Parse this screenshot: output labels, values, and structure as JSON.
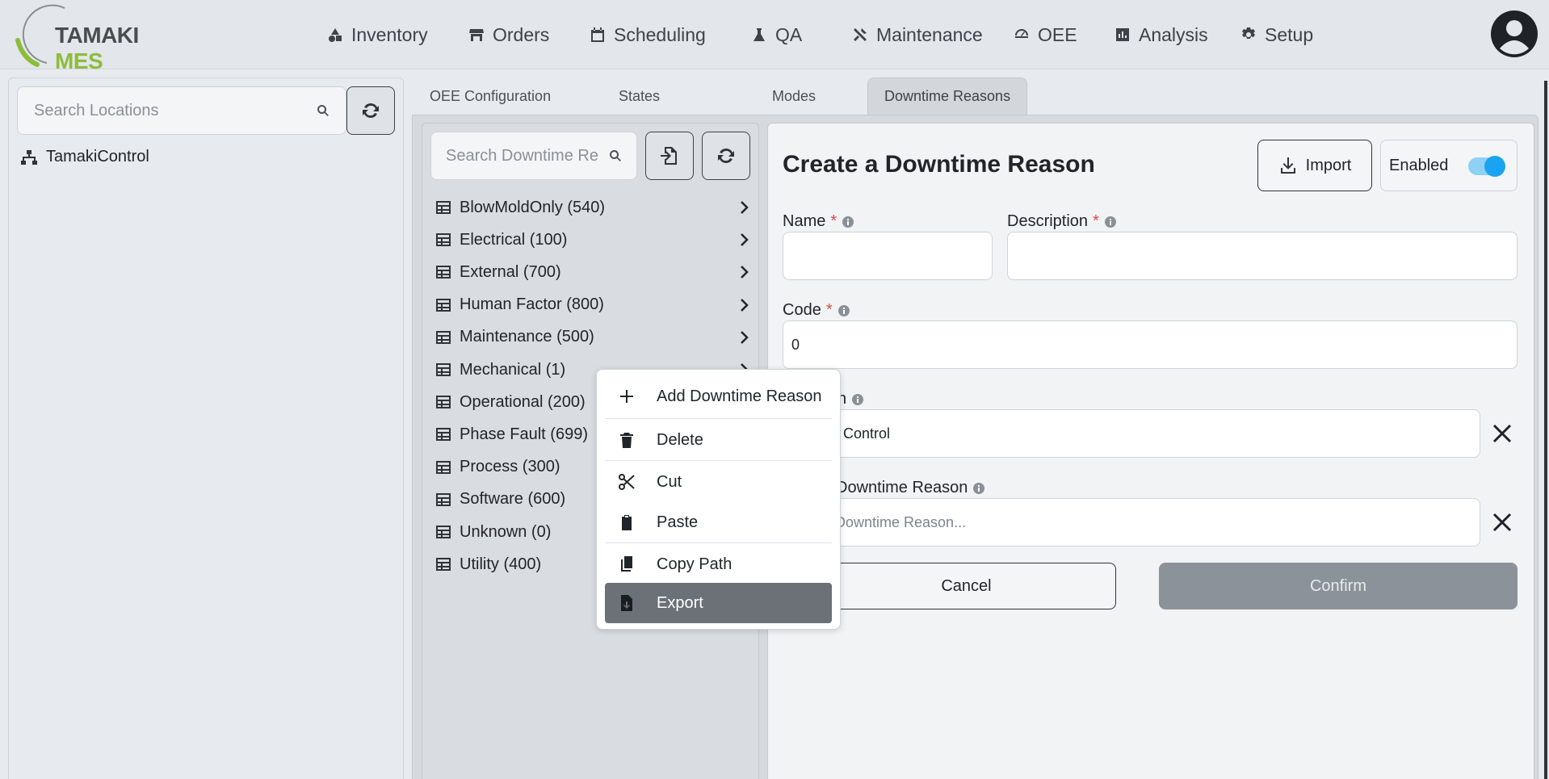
{
  "logo": {
    "part1": "TAMAKI",
    "part2": "MES"
  },
  "nav": [
    {
      "id": "inventory",
      "label": "Inventory",
      "icon": "shapes-icon"
    },
    {
      "id": "orders",
      "label": "Orders",
      "icon": "store-icon"
    },
    {
      "id": "scheduling",
      "label": "Scheduling",
      "icon": "calendar-icon"
    },
    {
      "id": "qa",
      "label": "QA",
      "icon": "flask-icon"
    },
    {
      "id": "maintenance",
      "label": "Maintenance",
      "icon": "tools-icon"
    },
    {
      "id": "oee",
      "label": "OEE",
      "icon": "gauge-icon"
    },
    {
      "id": "analysis",
      "label": "Analysis",
      "icon": "chart-icon"
    },
    {
      "id": "setup",
      "label": "Setup",
      "icon": "gear-icon"
    }
  ],
  "locations": {
    "search_placeholder": "Search Locations",
    "root": "TamakiControl"
  },
  "tabs": [
    {
      "label": "OEE Configuration",
      "active": false
    },
    {
      "label": "States",
      "active": false
    },
    {
      "label": "Modes",
      "active": false
    },
    {
      "label": "Downtime Reasons",
      "active": true
    }
  ],
  "reasons": {
    "search_placeholder": "Search Downtime Re",
    "items": [
      "BlowMoldOnly (540)",
      "Electrical (100)",
      "External (700)",
      "Human Factor (800)",
      "Maintenance (500)",
      "Mechanical (1)",
      "Operational (200)",
      "Phase Fault (699)",
      "Process (300)",
      "Software (600)",
      "Unknown (0)",
      "Utility (400)"
    ]
  },
  "form": {
    "title": "Create a Downtime Reason",
    "import_label": "Import",
    "enabled_label": "Enabled",
    "enabled": true,
    "name_label": "Name",
    "description_label": "Description",
    "code_label": "Code",
    "code_value": "0",
    "location_label_partial": "n",
    "location_value_partial": "Control",
    "parent_label_partial": "Downtime Reason",
    "parent_placeholder_partial": "Downtime Reason...",
    "required_mark": "*",
    "cancel_label": "Cancel",
    "confirm_label": "Confirm"
  },
  "context_menu": {
    "items": [
      {
        "label": "Add Downtime Reason",
        "icon": "plus-icon"
      },
      {
        "label": "Delete",
        "icon": "trash-icon"
      },
      {
        "label": "Cut",
        "icon": "scissors-icon"
      },
      {
        "label": "Paste",
        "icon": "clipboard-icon"
      },
      {
        "label": "Copy Path",
        "icon": "copy-icon"
      },
      {
        "label": "Export",
        "icon": "export-file-icon",
        "highlighted": true
      }
    ]
  },
  "colors": {
    "accent_green": "#8cbd3a",
    "toggle_blue": "#1aa3f0",
    "required_red": "#e0484a",
    "highlight_gray": "#6c7178"
  }
}
